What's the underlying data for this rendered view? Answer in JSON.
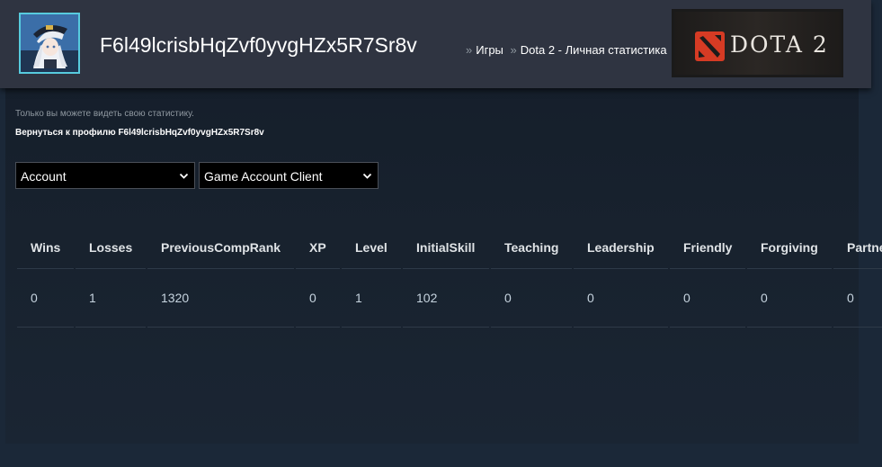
{
  "header": {
    "profile_name": "F6l49lcrisbHqZvf0yvgHZx5R7Sr8v",
    "breadcrumbs": [
      {
        "separator": "»",
        "label": "Игры"
      },
      {
        "separator": "»",
        "label": "Dota 2 - Личная статистика"
      }
    ],
    "game_logo": {
      "text": "DOTA 2",
      "icon": "dota-logo-icon",
      "accent": "#d63b24"
    }
  },
  "main": {
    "notice": "Только вы можете видеть свою статистику.",
    "back_link": "Вернуться к профилю F6l49lcrisbHqZvf0yvgHZx5R7Sr8v",
    "filters": [
      {
        "selected": "Account",
        "icon": "chevron-down-icon"
      },
      {
        "selected": "Game Account Client",
        "icon": "chevron-down-icon"
      }
    ],
    "stats_table": {
      "columns": [
        "Wins",
        "Losses",
        "PreviousCompRank",
        "XP",
        "Level",
        "InitialSkill",
        "Teaching",
        "Leadership",
        "Friendly",
        "Forgiving",
        "Partner"
      ],
      "rows": [
        [
          "0",
          "1",
          "1320",
          "0",
          "1",
          "102",
          "0",
          "0",
          "0",
          "0",
          "0"
        ]
      ]
    }
  },
  "colors": {
    "background": "#1b2838",
    "header": "#2f3441",
    "avatar_border": "#57cbde",
    "muted_text": "#8f98a0"
  }
}
